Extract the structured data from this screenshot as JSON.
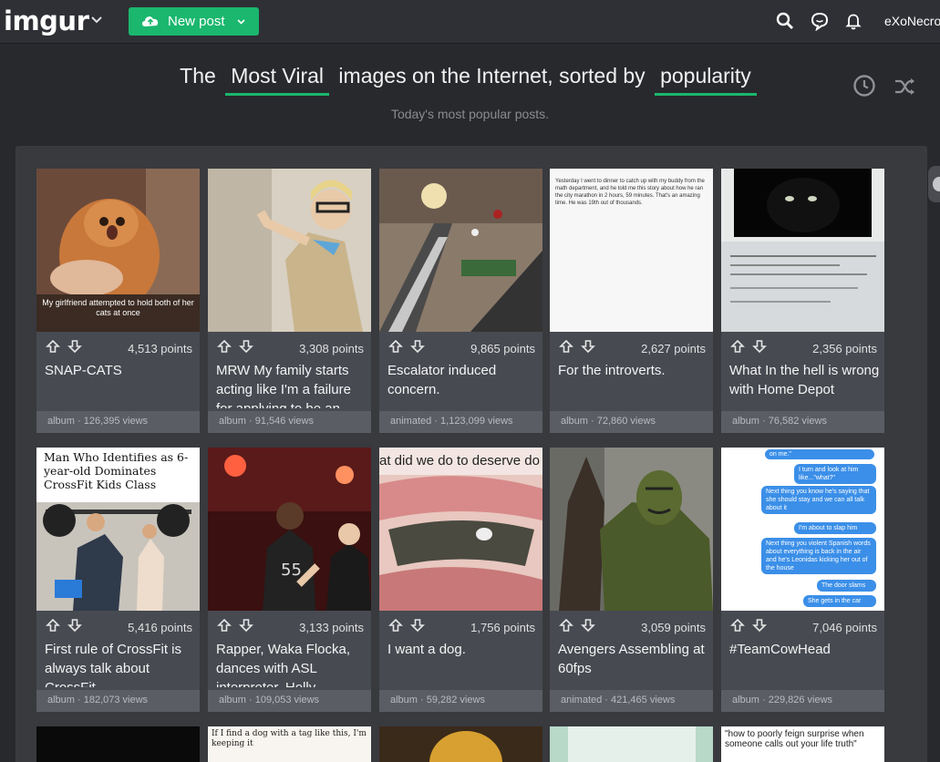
{
  "topbar": {
    "logo": "imgur",
    "new_post_label": "New post",
    "username": "eXoNecro",
    "icons": [
      "upload-cloud-icon",
      "chevron-down-icon",
      "search-icon",
      "chat-icon",
      "bell-icon"
    ]
  },
  "headline": {
    "prefix": "The",
    "section": "Most Viral",
    "middle": "images on the Internet, sorted by",
    "sort": "popularity",
    "subtitle": "Today's most popular posts."
  },
  "accent_color": "#1bb76e",
  "posts": [
    {
      "points": "4,513 points",
      "title": "SNAP-CATS",
      "meta": "album · 126,395 views",
      "caption": "My girlfriend attempted to hold both of her cats at once"
    },
    {
      "points": "3,308 points",
      "title": "MRW My family starts acting like I'm a failure for applying to be an",
      "meta": "album · 91,546 views"
    },
    {
      "points": "9,865 points",
      "title": "Escalator induced concern.",
      "meta": "animated · 1,123,099 views"
    },
    {
      "points": "2,627 points",
      "title": "For the introverts.",
      "meta": "album · 72,860 views",
      "doc_text": "Yesterday I went to dinner to catch up with my buddy from the math department, and he told me this story about how he ran the city marathon in 2 hours, 59 minutes. That's an amazing time. He was 19th out of thousands."
    },
    {
      "points": "2,356 points",
      "title": "What In the hell is wrong with Home Depot",
      "meta": "album · 76,582 views"
    },
    {
      "points": "5,416 points",
      "title": "First rule of CrossFit is always talk about CrossFit",
      "meta": "album · 182,073 views",
      "caption": "Man Who Identifies as 6-year-old Dominates CrossFit Kids Class"
    },
    {
      "points": "3,133 points",
      "title": "Rapper, Waka Flocka, dances with ASL interpreter, Holly",
      "meta": "album · 109,053 views"
    },
    {
      "points": "1,756 points",
      "title": "I want a dog.",
      "meta": "album · 59,282 views",
      "caption": "at did we do to deserve do"
    },
    {
      "points": "3,059 points",
      "title": "Avengers Assembling at 60fps",
      "meta": "animated · 421,465 views"
    },
    {
      "points": "7,046 points",
      "title": "#TeamCowHead",
      "meta": "album · 229,826 views",
      "chat": [
        "on me.\"",
        "I turn and look at him like...\"what?\"",
        "Next thing you know he's saying that she should stay and we can all talk about it",
        "I'm about to slap him",
        "Next thing you violent Spanish words about everything is back in the air and he's Leonidas kicking her out of the house",
        "The door slams",
        "She gets in the car"
      ]
    }
  ],
  "peek": {
    "second": "If I find a dog with a tag like this, I'm keeping it",
    "fifth": "\"how to poorly feign surprise when someone calls out your life truth\""
  }
}
